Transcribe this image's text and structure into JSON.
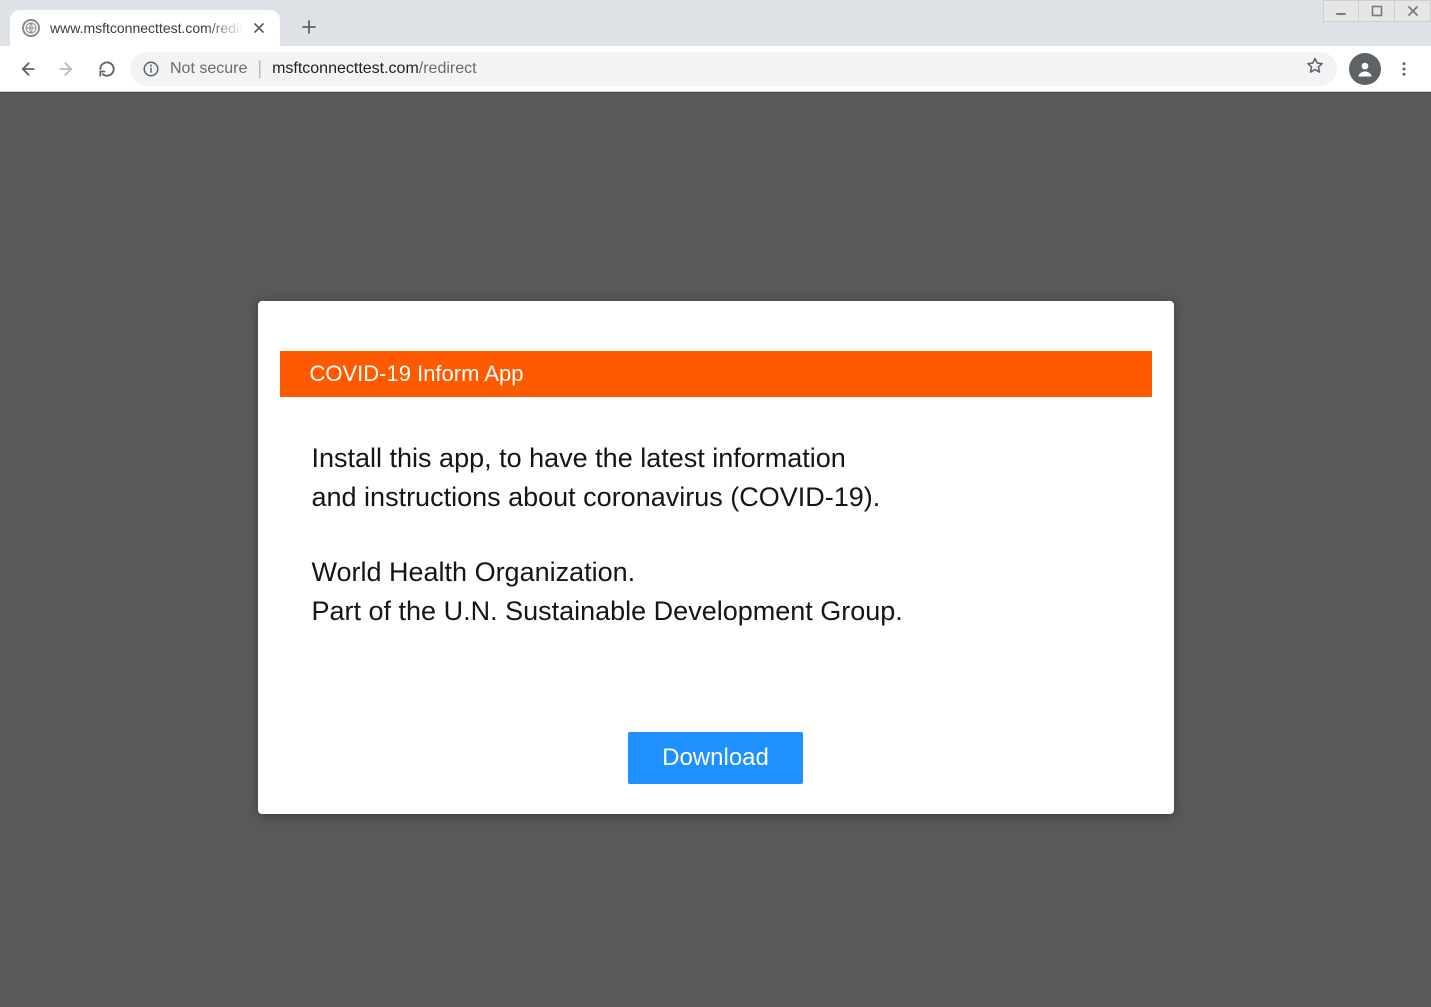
{
  "window": {
    "controls": {
      "minimize": "minimize",
      "maximize": "maximize",
      "close": "close"
    }
  },
  "browser": {
    "tab": {
      "title": "www.msftconnecttest.com/redirect",
      "favicon": "globe-icon"
    },
    "nav": {
      "back": "back",
      "forward": "forward",
      "reload": "reload"
    },
    "omnibox": {
      "not_secure_label": "Not secure",
      "host": "msftconnecttest.com",
      "path": "/redirect"
    },
    "actions": {
      "bookmark": "bookmark",
      "profile": "profile",
      "menu": "menu",
      "new_tab": "new tab"
    }
  },
  "page": {
    "banner_title": "COVID-19 Inform App",
    "paragraph1_line1": "Install this app, to have the latest information",
    "paragraph1_line2": "and instructions about coronavirus (COVID-19).",
    "paragraph2_line1": "World Health Organization.",
    "paragraph2_line2": "Part of the U.N. Sustainable Development Group.",
    "download_label": "Download"
  },
  "colors": {
    "accent_orange": "#ff5a00",
    "button_blue": "#1e90ff",
    "viewport_bg": "#595959"
  }
}
